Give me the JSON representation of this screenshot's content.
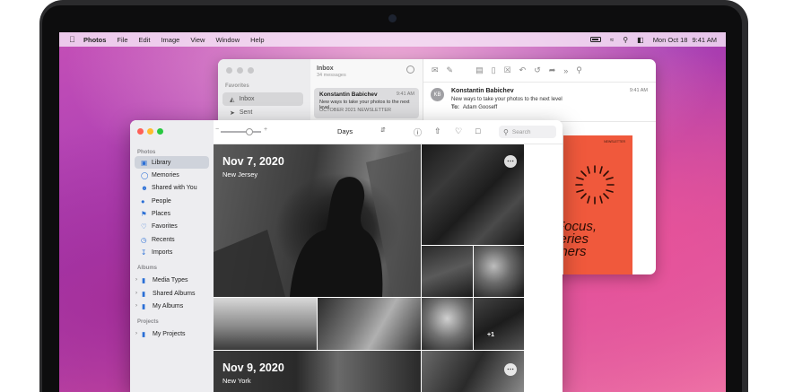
{
  "menubar": {
    "app": "Photos",
    "items": [
      "File",
      "Edit",
      "Image",
      "View",
      "Window",
      "Help"
    ],
    "date": "Mon Oct 18",
    "time": "9:41 AM"
  },
  "mail": {
    "sidebar": {
      "section": "Favorites",
      "inbox": "Inbox",
      "sent": "Sent"
    },
    "list": {
      "title": "Inbox",
      "count": "34 messages",
      "message": {
        "from": "Konstantin Babichev",
        "time": "9:41 AM",
        "subject": "New ways to take your photos to the next level",
        "preview": "OCTOBER 2021 NEWSLETTER"
      }
    },
    "viewer": {
      "avatar": "KB",
      "from": "Konstantin Babichev",
      "time": "9:41 AM",
      "subject": "New ways to take your photos to the next level",
      "to_label": "To:",
      "to": "Adam Gooseff"
    },
    "poster": {
      "tag": "NEWSLETTER",
      "lines": [
        "Focus,",
        "series",
        "phers"
      ]
    }
  },
  "photos": {
    "sidebar": {
      "photos_header": "Photos",
      "items": [
        {
          "label": "Library",
          "icon": "library-icon"
        },
        {
          "label": "Memories",
          "icon": "memories-icon"
        },
        {
          "label": "Shared with You",
          "icon": "shared-with-you-icon"
        },
        {
          "label": "People",
          "icon": "people-icon"
        },
        {
          "label": "Places",
          "icon": "places-icon"
        },
        {
          "label": "Favorites",
          "icon": "heart-icon"
        },
        {
          "label": "Recents",
          "icon": "clock-icon"
        },
        {
          "label": "Imports",
          "icon": "import-icon"
        }
      ],
      "albums_header": "Albums",
      "albums": [
        {
          "label": "Media Types",
          "icon": "folder-icon"
        },
        {
          "label": "Shared Albums",
          "icon": "folder-icon"
        },
        {
          "label": "My Albums",
          "icon": "folder-icon"
        }
      ],
      "projects_header": "Projects",
      "projects": [
        {
          "label": "My Projects",
          "icon": "folder-icon"
        }
      ]
    },
    "toolbar": {
      "view_mode": "Days",
      "search_placeholder": "Search",
      "zoom_level": 0.7
    },
    "groups": [
      {
        "date": "Nov 7, 2020",
        "location": "New Jersey",
        "overflow": "+1"
      },
      {
        "date": "Nov 9, 2020",
        "location": "New York"
      }
    ]
  }
}
